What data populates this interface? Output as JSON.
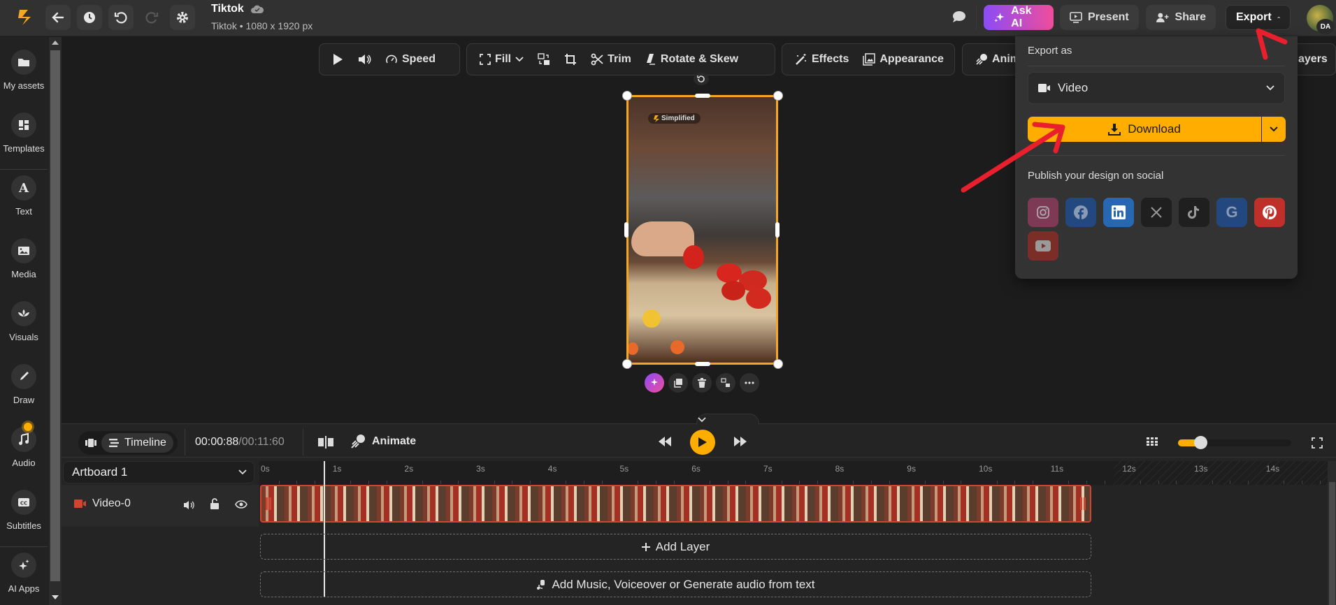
{
  "header": {
    "title": "Tiktok",
    "subtitle": "Tiktok • 1080 x 1920 px",
    "buttons": {
      "ask_ai": "Ask AI",
      "present": "Present",
      "share": "Share",
      "export": "Export"
    },
    "avatar_initials": "DA"
  },
  "sidebar": {
    "items": [
      {
        "label": "My assets",
        "icon": "folder-icon"
      },
      {
        "label": "Templates",
        "icon": "templates-icon"
      },
      {
        "label": "Text",
        "icon": "text-icon"
      },
      {
        "label": "Media",
        "icon": "image-icon"
      },
      {
        "label": "Visuals",
        "icon": "visuals-icon"
      },
      {
        "label": "Draw",
        "icon": "pen-icon"
      },
      {
        "label": "Audio",
        "icon": "music-icon"
      },
      {
        "label": "Subtitles",
        "icon": "cc-icon"
      },
      {
        "label": "AI Apps",
        "icon": "sparkles-icon"
      }
    ]
  },
  "toolbar": {
    "speed": "Speed",
    "fill": "Fill",
    "trim": "Trim",
    "rotate_skew": "Rotate & Skew",
    "effects": "Effects",
    "appearance": "Appearance",
    "animate_partial": "Anim",
    "layers_partial": "ayers"
  },
  "artboard": {
    "watermark": "Simplified"
  },
  "export_panel": {
    "title": "Export as",
    "format": "Video",
    "download": "Download",
    "publish_title": "Publish your design on social",
    "socials": [
      {
        "name": "instagram",
        "color": "#7e3a55"
      },
      {
        "name": "facebook",
        "color": "#22487f"
      },
      {
        "name": "linkedin",
        "color": "#2867b2"
      },
      {
        "name": "x",
        "color": "#1f1f1f"
      },
      {
        "name": "tiktok",
        "color": "#1f1f1f"
      },
      {
        "name": "google",
        "color": "#22487f"
      },
      {
        "name": "pinterest",
        "color": "#c0302a"
      },
      {
        "name": "youtube",
        "color": "#7a2e27"
      }
    ]
  },
  "timeline": {
    "tab_label": "Timeline",
    "current_time": "00:00:88",
    "total_time": "/00:11:60",
    "animate": "Animate",
    "zoom_level": 0.2,
    "artboard": "Artboard 1",
    "layer_name": "Video-0",
    "ruler_ticks": [
      "0s",
      "1s",
      "2s",
      "3s",
      "4s",
      "5s",
      "6s",
      "7s",
      "8s",
      "9s",
      "10s",
      "11s",
      "12s",
      "13s",
      "14s"
    ],
    "add_layer": "Add Layer",
    "add_audio": "Add Music, Voiceover or Generate audio from text"
  },
  "colors": {
    "accent": "#ffae00",
    "annotation": "#e8202e",
    "clip_border": "#d0452f"
  }
}
